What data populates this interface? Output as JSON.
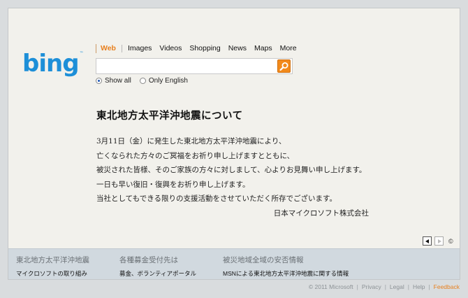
{
  "logo": {
    "text": "bing",
    "tm": "™"
  },
  "scopes": [
    {
      "label": "Web",
      "active": true
    },
    {
      "label": "Images"
    },
    {
      "label": "Videos"
    },
    {
      "label": "Shopping"
    },
    {
      "label": "News"
    },
    {
      "label": "Maps"
    },
    {
      "label": "More"
    }
  ],
  "search": {
    "value": "",
    "placeholder": ""
  },
  "filters": {
    "show_all": "Show all",
    "only_english": "Only English",
    "selected": "Show all"
  },
  "message": {
    "title": "東北地方太平洋沖地震について",
    "lines": [
      "3月11日（金）に発生した東北地方太平洋沖地震により、",
      "亡くなられた方々のご冥福をお祈り申し上げますとともに、",
      "被災された皆様、そのご家族の方々に対しまして、心よりお見舞い申し上げます。",
      "一日も早い復旧・復興をお祈り申し上げます。",
      "当社としてもできる限りの支援活動をさせていただく所存でございます。"
    ],
    "signature": "日本マイクロソフト株式会社"
  },
  "pager": {
    "copyright_symbol": "©"
  },
  "band": [
    {
      "title": "東北地方太平洋沖地震",
      "link": "マイクロソフトの取り組み"
    },
    {
      "title": "各種募金受付先は",
      "link": "募金、ボランティアポータル"
    },
    {
      "title": "被災地域全域の安否情報",
      "link": "MSNによる東北地方太平洋沖地震に関する情報"
    }
  ],
  "footer": {
    "copyright": "© 2011 Microsoft",
    "privacy": "Privacy",
    "legal": "Legal",
    "help": "Help",
    "feedback": "Feedback"
  },
  "colors": {
    "accent": "#e8801f",
    "logo": "#1d8fd8",
    "panel": "#f2f1ec",
    "band": "#d1d9df"
  }
}
